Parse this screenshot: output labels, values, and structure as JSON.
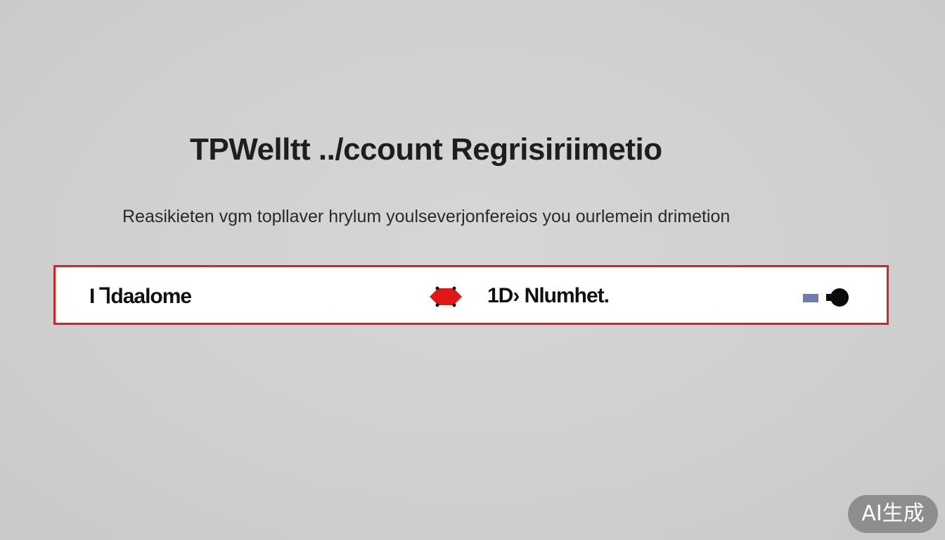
{
  "page": {
    "title": "TPWelltt ../ccount Regrisiriimetio",
    "subtitle": "Reasikieten vgm topllaver hrylum youlseverjonfereios you ourlemein drimetion"
  },
  "form_bar": {
    "left_field": "I ⅂daalome",
    "right_field": "1D› Nlumhet.",
    "swap_icon": "swap-arrows-icon",
    "toggle_icon": "toggle-switch-icon",
    "border_color": "#d42424"
  },
  "badge": {
    "label": "AI生成"
  }
}
